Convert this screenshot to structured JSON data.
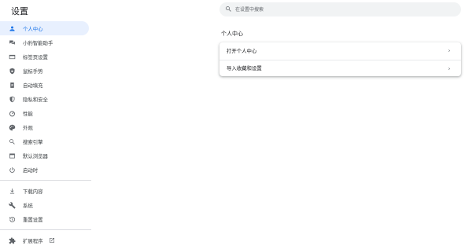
{
  "header": {
    "title": "设置"
  },
  "search": {
    "placeholder": "在设置中搜索"
  },
  "sidebar": {
    "items": [
      {
        "label": "个人中心",
        "icon": "person-icon",
        "active": true
      },
      {
        "label": "小豹智能助手",
        "icon": "assistant-icon"
      },
      {
        "label": "标签页设置",
        "icon": "tab-icon"
      },
      {
        "label": "鼠标手势",
        "icon": "shield-icon"
      },
      {
        "label": "自动填充",
        "icon": "clipboard-icon"
      },
      {
        "label": "隐私和安全",
        "icon": "security-shield-icon"
      },
      {
        "label": "性能",
        "icon": "speedometer-icon"
      },
      {
        "label": "外观",
        "icon": "palette-icon"
      },
      {
        "label": "搜索引擎",
        "icon": "search-icon"
      },
      {
        "label": "默认浏览器",
        "icon": "browser-icon"
      },
      {
        "label": "启动时",
        "icon": "power-icon"
      }
    ],
    "advanced": [
      {
        "label": "下载内容",
        "icon": "download-icon"
      },
      {
        "label": "系统",
        "icon": "wrench-icon"
      },
      {
        "label": "重置设置",
        "icon": "history-icon"
      }
    ],
    "extensions": {
      "label": "扩展程序",
      "icon": "puzzle-icon"
    }
  },
  "main": {
    "section_title": "个人中心",
    "rows": [
      {
        "label": "打开个人中心"
      },
      {
        "label": "导入收藏和设置"
      }
    ]
  },
  "colors": {
    "accent": "#1a73e8",
    "active_bg": "#e8f0fe",
    "icon": "#5f6368"
  }
}
